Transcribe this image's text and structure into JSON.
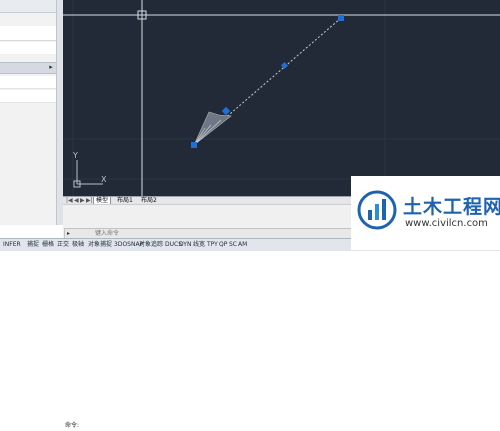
{
  "tabs": {
    "model": "模型",
    "layout1": "布局1",
    "layout2": "布局2",
    "nav_first": "|◀",
    "nav_prev": "◀",
    "nav_next": "▶",
    "nav_last": "▶|"
  },
  "command": {
    "history_label": "命令:",
    "prompt_symbol": "▸",
    "input_placeholder": "键入命令"
  },
  "status_bar": {
    "items": [
      "INFER",
      "捕捉",
      "栅格",
      "正交",
      "极轴",
      "对象捕捉",
      "3DOSNAP",
      "对象追踪",
      "DUCS",
      "DYN",
      "线宽",
      "TPY",
      "QP",
      "SC",
      "AM"
    ]
  },
  "ucs": {
    "y_label": "Y",
    "x_label": "X"
  },
  "watermark": {
    "title": "土木工程网",
    "url": "www.civilcn.com"
  },
  "colors": {
    "canvas_bg": "#212a36",
    "grip_blue": "#1f6fd6",
    "crosshair": "#d8dde6",
    "watermark_blue": "#1e63b0"
  }
}
